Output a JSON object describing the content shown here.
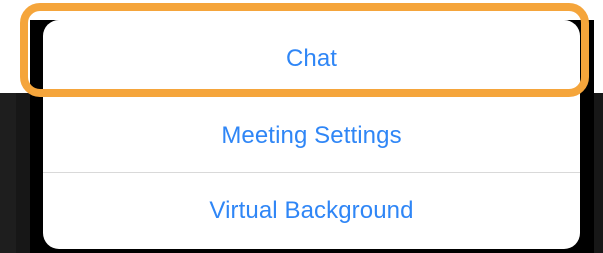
{
  "menu": {
    "items": [
      {
        "label": "Chat"
      },
      {
        "label": "Meeting Settings"
      },
      {
        "label": "Virtual Background"
      }
    ]
  },
  "colors": {
    "accent": "#2f86f6",
    "highlight": "#f5a53b",
    "sheet_background": "#ffffff",
    "screen_background": "#171717",
    "divider": "#d9d9d9"
  }
}
